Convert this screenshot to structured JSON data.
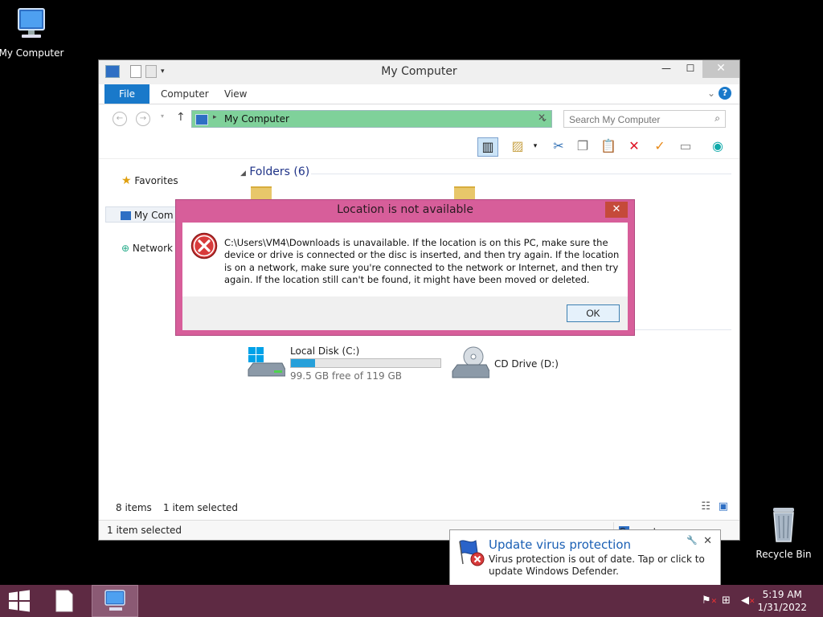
{
  "desktop": {
    "my_computer_label": "My Computer",
    "recycle_bin_label": "Recycle Bin"
  },
  "explorer": {
    "title": "My Computer",
    "tabs": [
      "File",
      "Computer",
      "View"
    ],
    "address": "My Computer",
    "search_placeholder": "Search My Computer",
    "nav": {
      "favorites": "Favorites",
      "my_computer": "My Com",
      "network": "Network"
    },
    "folders_header": "Folders (6)",
    "drives": [
      {
        "name": "Local Disk (C:)",
        "free_text": "99.5 GB free of 119 GB",
        "used_fraction": 0.16
      },
      {
        "name": "CD Drive (D:)"
      }
    ],
    "status": {
      "items": "8 items",
      "selected": "1 item selected",
      "bottom_selected": "1 item selected",
      "bottom_right": "Computer"
    }
  },
  "dialog": {
    "title": "Location is not available",
    "close_label": "✕",
    "message": "C:\\Users\\VM4\\Downloads is unavailable. If the location is on this PC, make sure the device or drive is connected or the disc is inserted, and then try again. If the location is on a network, make sure you're connected to the network or Internet, and then try again. If the location still can't be found, it might have been moved or deleted.",
    "ok_label": "OK"
  },
  "toast": {
    "title": "Update virus protection",
    "message": "Virus protection is out of date. Tap or click to update Windows Defender."
  },
  "taskbar": {
    "time": "5:19 AM",
    "date": "1/31/2022"
  },
  "colors": {
    "dialog_frame": "#d75e9a",
    "taskbar": "#5e2a43",
    "address_highlight": "#7fd19a",
    "file_tab": "#1979ca"
  }
}
